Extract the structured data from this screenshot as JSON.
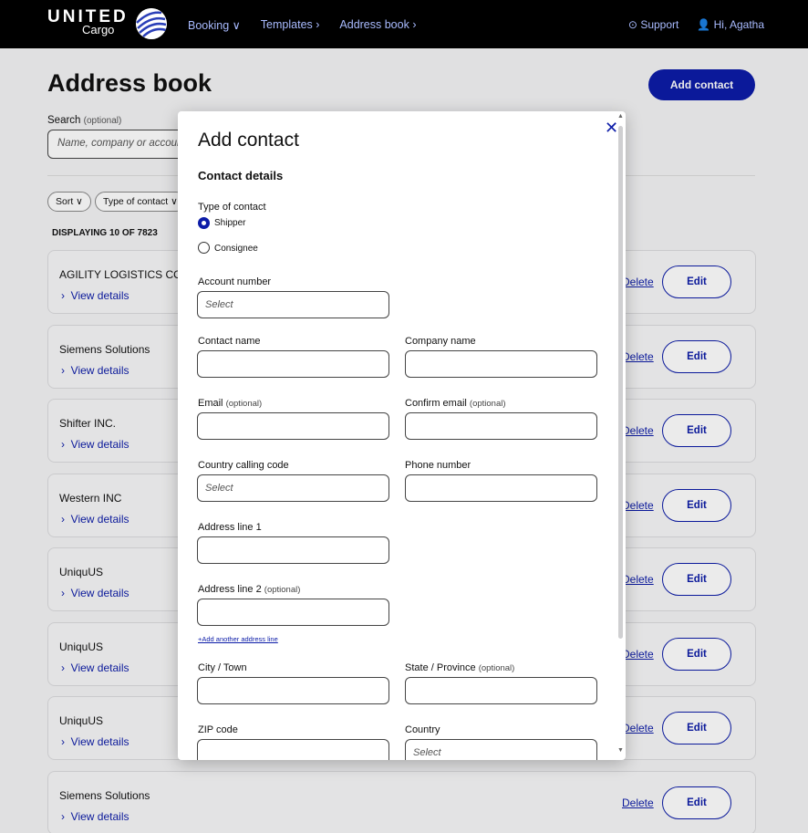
{
  "brand": {
    "word": "UNITED",
    "sub": "Cargo"
  },
  "nav": {
    "links": [
      "Booking ∨",
      "Templates ›",
      "Address book ›"
    ],
    "support": "Support",
    "greeting": "Hi, Agatha"
  },
  "page": {
    "title": "Address book",
    "add_contact_label": "Add contact",
    "search_label": "Search",
    "search_optional": "(optional)",
    "search_placeholder": "Name, company or account",
    "sort_chip": "Sort ∨",
    "type_chip": "Type of contact ∨",
    "displaying": "DISPLAYING 10 OF 7823"
  },
  "rows": [
    {
      "name": "AGILITY LOGISTICS CORP"
    },
    {
      "name": "Siemens Solutions"
    },
    {
      "name": "Shifter INC."
    },
    {
      "name": "Western INC"
    },
    {
      "name": "UniquUS"
    },
    {
      "name": "UniquUS"
    },
    {
      "name": "UniquUS"
    },
    {
      "name": "Siemens Solutions"
    }
  ],
  "row_labels": {
    "view": "View details",
    "delete": "Delete",
    "edit": "Edit"
  },
  "modal": {
    "title": "Add contact",
    "subtitle": "Contact details",
    "type_label": "Type of contact",
    "shipper": "Shipper",
    "consignee": "Consignee",
    "account_number": "Account number",
    "account_placeholder": "Select",
    "contact_name": "Contact name",
    "company_name": "Company name",
    "email": "Email",
    "confirm_email": "Confirm email",
    "optional": "(optional)",
    "country_code": "Country calling code",
    "country_code_placeholder": "Select",
    "phone": "Phone number",
    "address1": "Address line 1",
    "address2": "Address line 2",
    "add_line": "+Add another address line",
    "city": "City / Town",
    "state": "State / Province",
    "zip": "ZIP code",
    "country": "Country",
    "country_placeholder": "Select"
  }
}
